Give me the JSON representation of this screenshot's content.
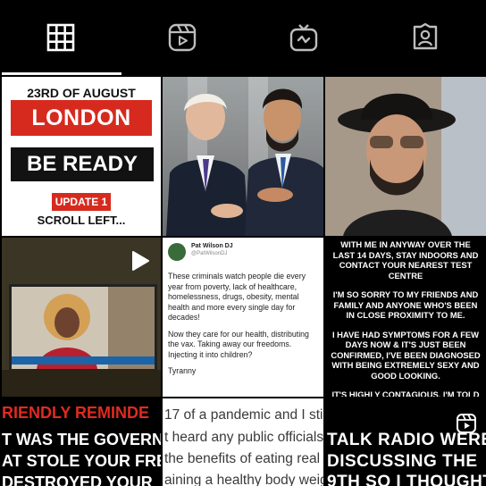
{
  "tabs": [
    {
      "name": "grid-icon",
      "active": true
    },
    {
      "name": "reels-icon",
      "active": false
    },
    {
      "name": "igtv-icon",
      "active": false
    },
    {
      "name": "tagged-icon",
      "active": false
    }
  ],
  "posts": {
    "p1": {
      "date": "23RD OF AUGUST",
      "headline1": "LONDON",
      "headline2": "BE READY",
      "badge": "UPDATE 1",
      "footer": "SCROLL LEFT..."
    },
    "p5": {
      "name": "Pat Wilson DJ",
      "handle": "@PatWilsonDJ",
      "para1": "These criminals watch people die every year from poverty, lack of healthcare, homelessness, drugs, obesity, mental health and more every single day for decades!",
      "para2": "Now they care for our health, distributing the vax. Taking away our freedoms. Injecting it into children?",
      "para3": "Tyranny"
    },
    "p6": {
      "para1": "WITH ME IN ANYWAY OVER THE LAST 14 DAYS, STAY INDOORS AND CONTACT YOUR NEAREST TEST CENTRE",
      "para2": "I'M SO SORRY TO MY FRIENDS AND FAMILY AND ANYONE WHO'S BEEN IN CLOSE PROXIMITY TO ME.",
      "para3": "I HAVE HAD SYMPTOMS FOR A FEW DAYS NOW & IT'S JUST BEEN CONFIRMED, I'VE BEEN DIAGNOSED WITH BEING EXTREMELY SEXY AND GOOD LOOKING.",
      "para4": "IT'S HIGHLY CONTAGIOUS. I'M TOLD"
    },
    "p7": {
      "line1": "RIENDLY REMINDE",
      "line2": "T WAS THE GOVERNMEN",
      "line3": "AT STOLE YOUR FREEDO",
      "line4": "DESTROYED YOUR"
    },
    "p8": {
      "line1": "17 of a pandemic and I stil",
      "line2": "t heard any public officials",
      "line3": "the benefits of eating real f",
      "line4": "aining a healthy body weigh"
    },
    "p9": {
      "line1": "TALK RADIO WERE",
      "line2": "DISCUSSING THE",
      "line3": "9TH SO I THOUGHT"
    }
  },
  "colors": {
    "accent_red": "#d72a1f",
    "background": "#000000",
    "tab_active": "#f2f2f2"
  }
}
